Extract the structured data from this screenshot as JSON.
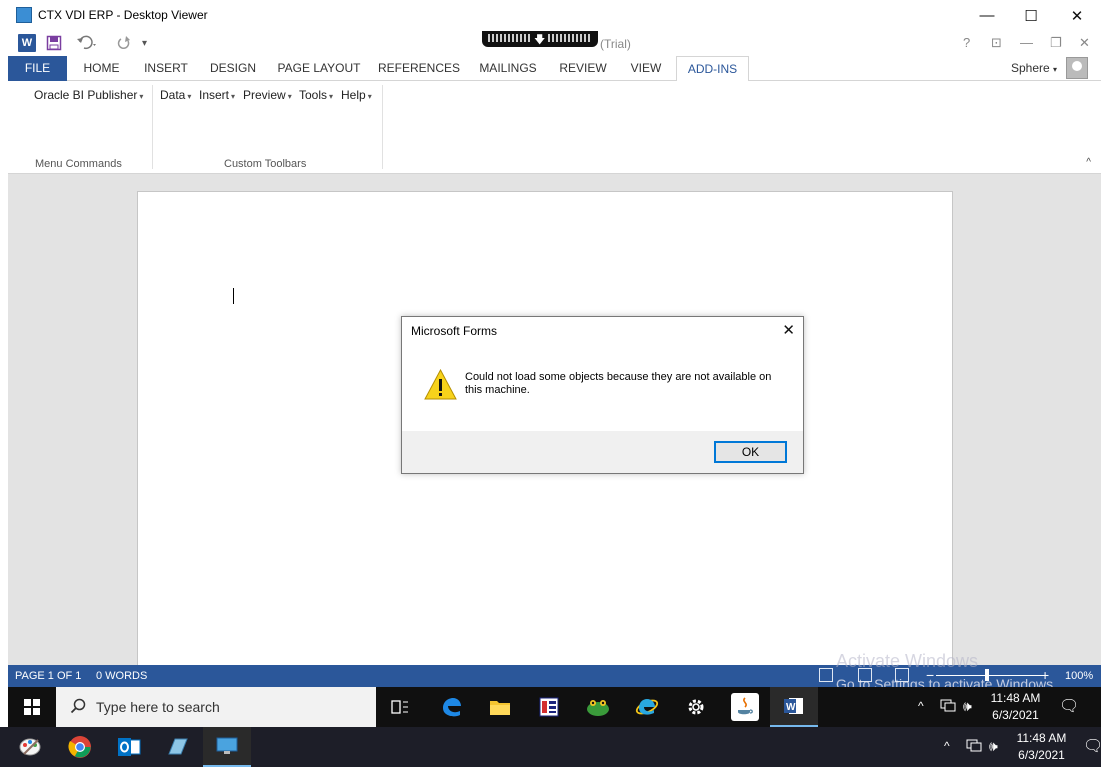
{
  "outer_window": {
    "title": "CTX VDI ERP - Desktop Viewer",
    "minimize_glyph": "—",
    "maximize_glyph": "☐",
    "close_glyph": "✕"
  },
  "qat": {
    "word_logo": "W",
    "save_icon": "save-icon",
    "undo_icon": "undo-icon",
    "redo_icon": "redo-icon",
    "customize_glyph": "▾",
    "doc_title_suffix": "(Trial)",
    "help_glyph": "?",
    "ribbon_display_glyph": "⊡",
    "minimize_glyph": "—",
    "restore_glyph": "❐",
    "close_glyph": "✕"
  },
  "tabs": {
    "file": "FILE",
    "home": "HOME",
    "insert": "INSERT",
    "design": "DESIGN",
    "page_layout": "PAGE LAYOUT",
    "references": "REFERENCES",
    "mailings": "MAILINGS",
    "review": "REVIEW",
    "view": "VIEW",
    "addins": "ADD-INS",
    "user_name": "Sphere",
    "user_caret": "▾"
  },
  "ribbon": {
    "oracle_bi_publisher": "Oracle BI Publisher",
    "data": "Data",
    "insert": "Insert",
    "preview": "Preview",
    "tools": "Tools",
    "help": "Help",
    "caret": "▾",
    "group_menu_commands": "Menu Commands",
    "group_custom_toolbars": "Custom Toolbars",
    "collapse_glyph": "^"
  },
  "dialog": {
    "title": "Microsoft Forms",
    "close_glyph": "✕",
    "message": "Could not load some objects because they are not available on this machine.",
    "ok_label": "OK",
    "warn_mark": "!"
  },
  "statusbar": {
    "page": "PAGE 1 OF 1",
    "words": "0 WORDS",
    "zoom_minus": "−",
    "zoom_plus": "+",
    "zoom": "100%",
    "zoom_fraction": 0.5
  },
  "watermark": {
    "line1": "Activate Windows",
    "line2": "Go to Settings to activate Windows."
  },
  "taskbar": {
    "search_placeholder": "Type here to search",
    "time": "11:48 AM",
    "date": "6/3/2021",
    "tray_up_glyph": "^",
    "volume_glyph": "🕪",
    "notification_glyph": "🗨"
  },
  "local_taskbar": {
    "time": "11:48 AM",
    "date": "6/3/2021",
    "tray_up_glyph": "^",
    "volume_glyph": "🕪",
    "notification_glyph": "🗨"
  },
  "colors": {
    "word_blue": "#2b579a",
    "taskbar_dark": "#101010",
    "dialog_ok_border": "#0078d7"
  }
}
